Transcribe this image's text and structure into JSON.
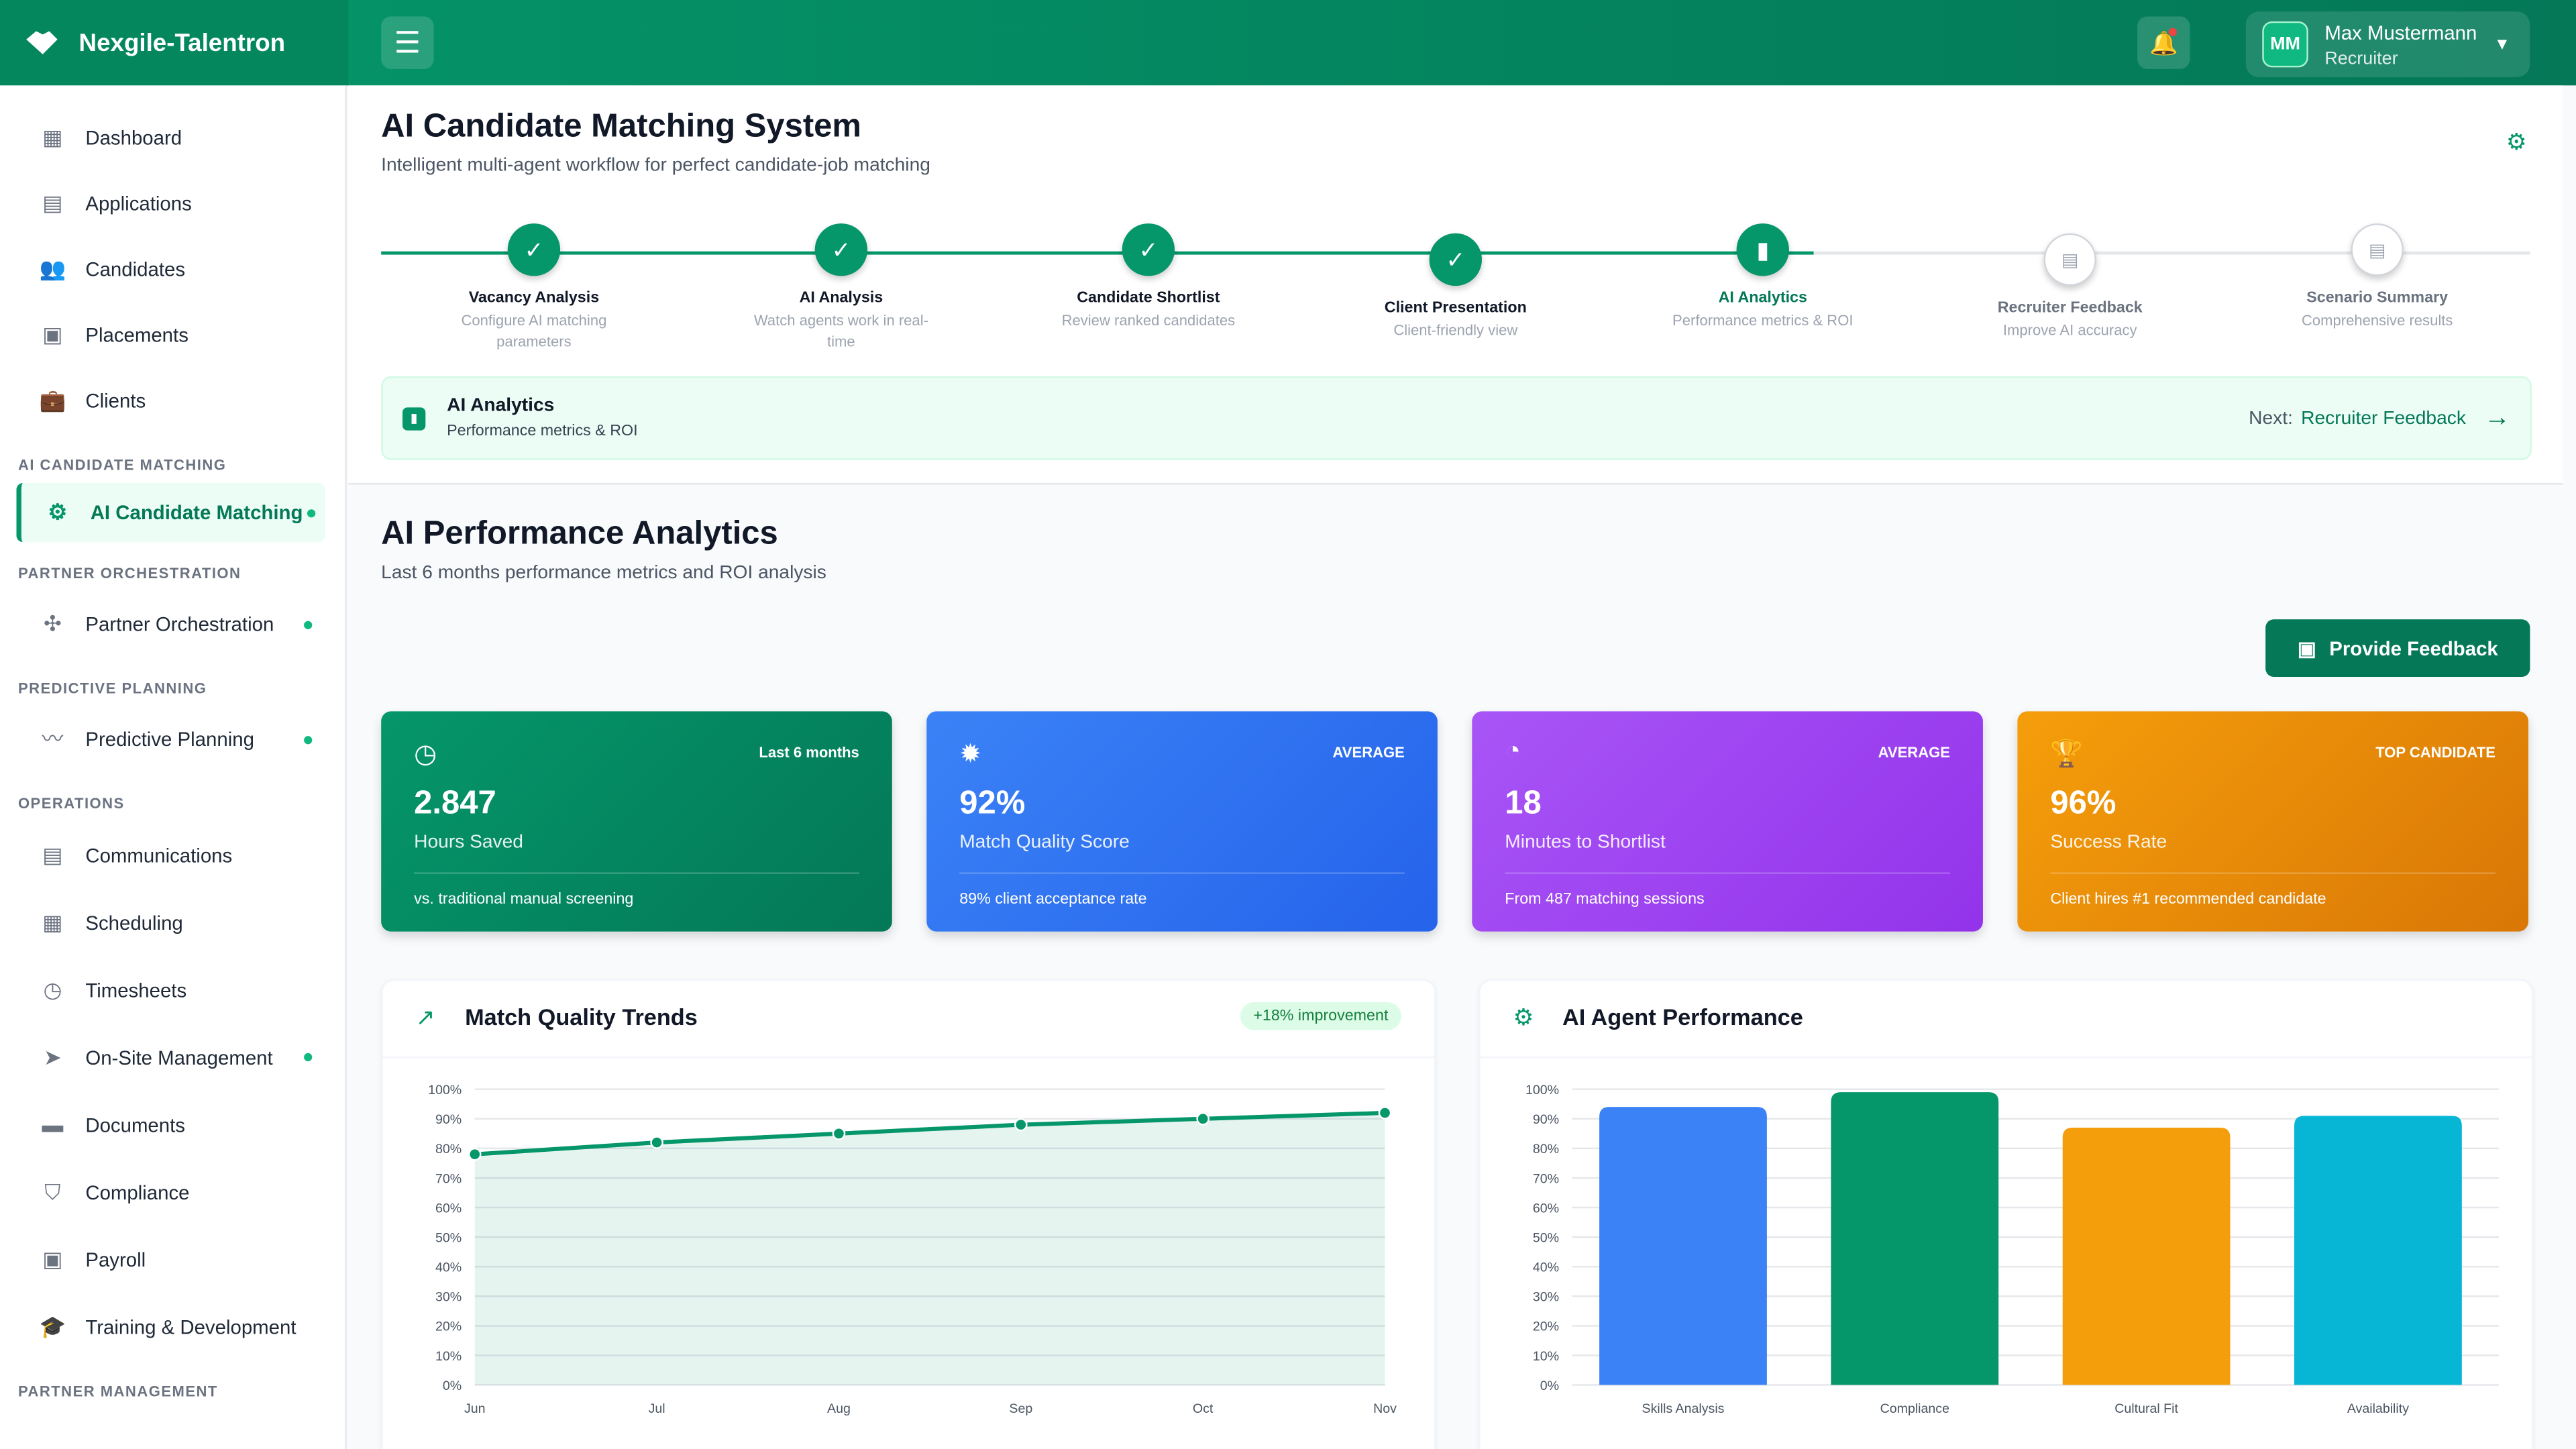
{
  "app": {
    "name": "Nexgile-Talentron"
  },
  "user": {
    "initials": "MM",
    "name": "Max Mustermann",
    "role": "Recruiter"
  },
  "sidebar": {
    "items_top": [
      {
        "label": "Dashboard",
        "icon": "dashboard-icon"
      },
      {
        "label": "Applications",
        "icon": "applications-icon"
      },
      {
        "label": "Candidates",
        "icon": "candidates-icon"
      },
      {
        "label": "Placements",
        "icon": "placements-icon"
      },
      {
        "label": "Clients",
        "icon": "clients-icon"
      }
    ],
    "sections": {
      "ai": "AI CANDIDATE MATCHING",
      "partner": "PARTNER ORCHESTRATION",
      "predictive": "PREDICTIVE PLANNING",
      "operations": "OPERATIONS",
      "partner_mgmt": "PARTNER MANAGEMENT"
    },
    "ai_item": "AI Candidate Matching",
    "partner_item": "Partner Orchestration",
    "predictive_item": "Predictive Planning",
    "ops_items": [
      {
        "label": "Communications"
      },
      {
        "label": "Scheduling"
      },
      {
        "label": "Timesheets"
      },
      {
        "label": "On-Site Management"
      },
      {
        "label": "Documents"
      },
      {
        "label": "Compliance"
      },
      {
        "label": "Payroll"
      },
      {
        "label": "Training & Development"
      }
    ]
  },
  "page": {
    "title": "AI Candidate Matching System",
    "subtitle": "Intelligent multi-agent workflow for perfect candidate-job matching"
  },
  "steps": [
    {
      "title": "Vacancy Analysis",
      "desc": "Configure AI matching parameters",
      "status": "done"
    },
    {
      "title": "AI Analysis",
      "desc": "Watch agents work in real-time",
      "status": "done"
    },
    {
      "title": "Candidate Shortlist",
      "desc": "Review ranked candidates",
      "status": "done"
    },
    {
      "title": "Client Presentation",
      "desc": "Client-friendly view",
      "status": "done"
    },
    {
      "title": "AI Analytics",
      "desc": "Performance metrics & ROI",
      "status": "active"
    },
    {
      "title": "Recruiter Feedback",
      "desc": "Improve AI accuracy",
      "status": "pending"
    },
    {
      "title": "Scenario Summary",
      "desc": "Comprehensive results",
      "status": "pending"
    }
  ],
  "banner": {
    "title": "AI Analytics",
    "desc": "Performance metrics & ROI",
    "next_label": "Next:",
    "next_step": "Recruiter Feedback"
  },
  "analytics": {
    "title": "AI Performance Analytics",
    "subtitle": "Last 6 months performance metrics and ROI analysis",
    "feedback_button": "Provide Feedback"
  },
  "cards": [
    {
      "tag": "Last 6 months",
      "value": "2.847",
      "label": "Hours Saved",
      "footer": "vs. traditional manual screening",
      "color": "#059669"
    },
    {
      "tag": "AVERAGE",
      "value": "92%",
      "label": "Match Quality Score",
      "footer": "89% client acceptance rate",
      "color": "#2563eb"
    },
    {
      "tag": "AVERAGE",
      "value": "18",
      "label": "Minutes to Shortlist",
      "footer": "From 487 matching sessions",
      "color": "#9333ea"
    },
    {
      "tag": "TOP CANDIDATE",
      "value": "96%",
      "label": "Success Rate",
      "footer": "Client hires #1 recommended candidate",
      "color": "#ea580c"
    }
  ],
  "chart_data": [
    {
      "type": "line",
      "title": "Match Quality Trends",
      "badge": "+18% improvement",
      "categories": [
        "Jun",
        "Jul",
        "Aug",
        "Sep",
        "Oct",
        "Nov"
      ],
      "values": [
        78,
        82,
        85,
        88,
        90,
        92
      ],
      "ylim": [
        0,
        100
      ],
      "yticks": [
        "0%",
        "10%",
        "20%",
        "30%",
        "40%",
        "50%",
        "60%",
        "70%",
        "80%",
        "90%",
        "100%"
      ],
      "color": "#059669"
    },
    {
      "type": "bar",
      "title": "AI Agent Performance",
      "categories": [
        "Skills Analysis",
        "Compliance",
        "Cultural Fit",
        "Availability"
      ],
      "values": [
        94,
        99,
        87,
        91
      ],
      "colors": [
        "#3b82f6",
        "#059669",
        "#f59e0b",
        "#06b6d4"
      ],
      "ylim": [
        0,
        100
      ],
      "yticks": [
        "0%",
        "10%",
        "20%",
        "30%",
        "40%",
        "50%",
        "60%",
        "70%",
        "80%",
        "90%",
        "100%"
      ]
    }
  ]
}
